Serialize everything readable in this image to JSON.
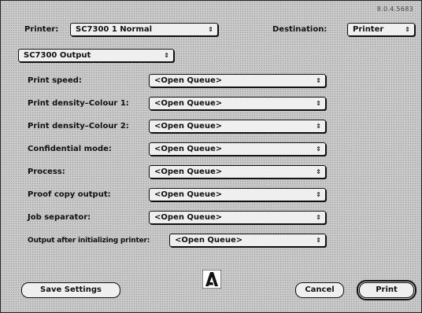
{
  "version": "8.0.4.5683",
  "header": {
    "printer_label": "Printer:",
    "printer_value": "SC7300 1 Normal",
    "destination_label": "Destination:",
    "destination_value": "Printer"
  },
  "section_popup": "SC7300 Output",
  "options": [
    {
      "label": "Print speed:",
      "value": "<Open Queue>"
    },
    {
      "label": "Print density–Colour 1:",
      "value": "<Open Queue>"
    },
    {
      "label": "Print density–Colour 2:",
      "value": "<Open Queue>"
    },
    {
      "label": "Confidential mode:",
      "value": "<Open Queue>"
    },
    {
      "label": "Process:",
      "value": "<Open Queue>"
    },
    {
      "label": "Proof copy output:",
      "value": "<Open Queue>"
    },
    {
      "label": "Job separator:",
      "value": "<Open Queue>"
    },
    {
      "label": "Output after initializing printer:",
      "value": "<Open Queue>"
    }
  ],
  "buttons": {
    "save_settings": "Save Settings",
    "cancel": "Cancel",
    "print": "Print"
  },
  "icons": {
    "popup_arrow": "updown-arrows-icon",
    "logo": "adobe-logo-icon"
  }
}
